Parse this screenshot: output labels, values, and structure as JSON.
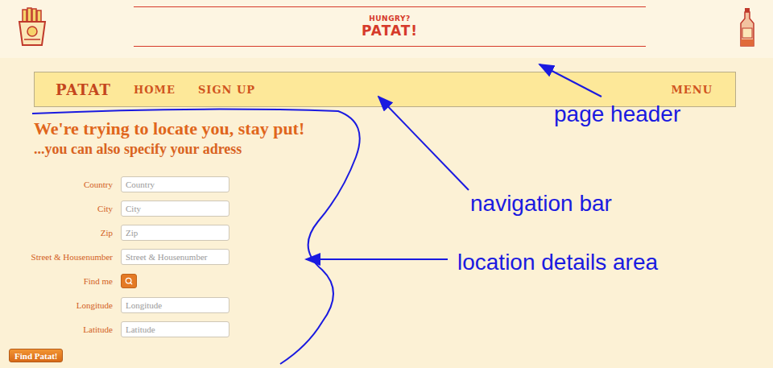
{
  "header": {
    "kicker": "HUNGRY?",
    "title": "PATAT!"
  },
  "nav": {
    "brand": "PATAT",
    "items": [
      {
        "label": "HOME"
      },
      {
        "label": "SIGN UP"
      }
    ],
    "menu": "MENU"
  },
  "location": {
    "title": "We're trying to locate you, stay put!",
    "subtitle": "...you can also specify your adress",
    "fields": [
      {
        "label": "Country",
        "placeholder": "Country",
        "kind": "input"
      },
      {
        "label": "City",
        "placeholder": "City",
        "kind": "input"
      },
      {
        "label": "Zip",
        "placeholder": "Zip",
        "kind": "input"
      },
      {
        "label": "Street & Housenumber",
        "placeholder": "Street & Housenumber",
        "kind": "input"
      },
      {
        "label": "Find me",
        "kind": "button"
      },
      {
        "label": "Longitude",
        "placeholder": "Longitude",
        "kind": "input"
      },
      {
        "label": "Latitude",
        "placeholder": "Latitude",
        "kind": "input"
      }
    ],
    "submit": "Find Patat!"
  },
  "annotations": [
    {
      "label": "page header"
    },
    {
      "label": "navigation bar"
    },
    {
      "label": "location details area"
    }
  ]
}
